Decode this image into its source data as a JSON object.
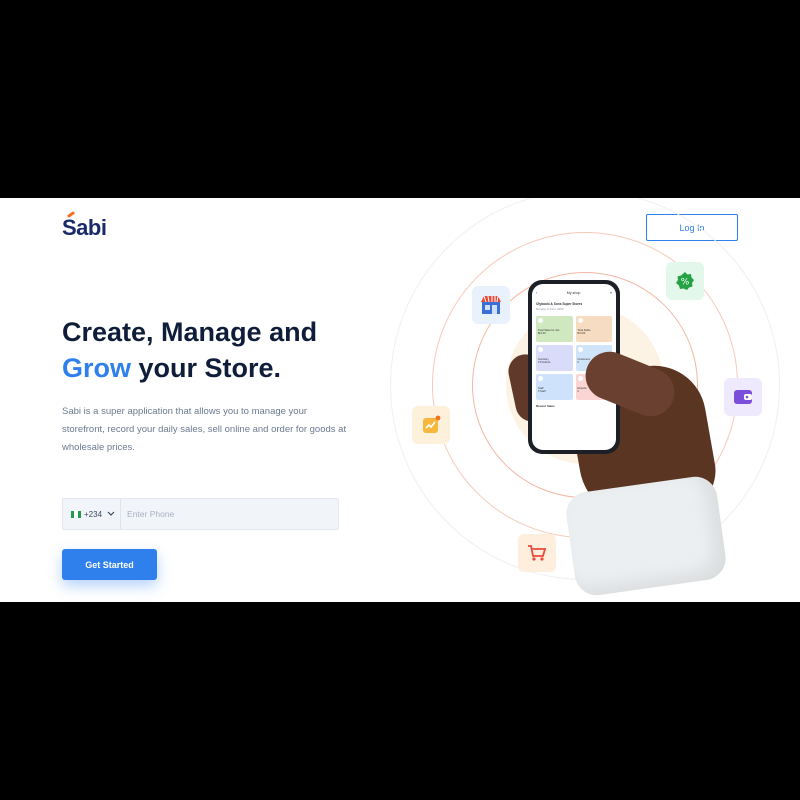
{
  "brand": {
    "logo_text": "Sabi",
    "accent_color": "#2f80ed",
    "logo_color": "#1b2a6b",
    "logo_tick_color": "#f37021"
  },
  "header": {
    "login_label": "Log In"
  },
  "hero": {
    "headline_line1": "Create, Manage and",
    "headline_accent": "Grow",
    "headline_rest": " your Store.",
    "description": "Sabi is a super application that allows you to manage your storefront, record your daily sales, sell online and order for goods at wholesale prices."
  },
  "form": {
    "country_code": "+234",
    "country_flag": "nigeria-flag",
    "phone_placeholder": "Enter Phone",
    "submit_label": "Get Started"
  },
  "phone_screen": {
    "title": "My shop",
    "store_name": "Olybaolo & Sons Super Stores",
    "date": "Monday, 8 June, 2020",
    "tiles": [
      {
        "label": "Total Sales for Jan",
        "value": "₦ 0.00",
        "color": "#cfe8c0"
      },
      {
        "label": "Total Debts",
        "value": "₦ 0.00",
        "color": "#f6dcc0"
      },
      {
        "label": "Inventory",
        "value": "0 Products",
        "color": "#d8dcf8"
      },
      {
        "label": "Customers",
        "value": "0",
        "color": "#cfe4f8"
      },
      {
        "label": "Staff",
        "value": "0 Staff",
        "color": "#cfe2fb"
      },
      {
        "label": "Reports",
        "value": "0",
        "color": "#fbd4d4"
      }
    ],
    "recent_label": "Recent Sales"
  },
  "floating_icons": [
    "store-icon",
    "verified-badge-icon",
    "wallet-icon",
    "growth-chart-icon",
    "shopping-cart-icon"
  ]
}
